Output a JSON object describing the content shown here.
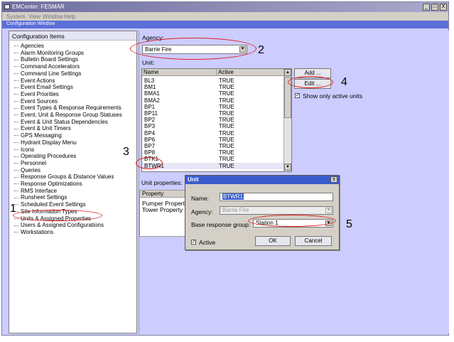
{
  "window": {
    "title": "EMCenter: FESMAR",
    "min": "_",
    "max": "□",
    "close": "X"
  },
  "menu": [
    "System",
    "View",
    "Window",
    "Help"
  ],
  "subwindow_title": "Configuration Window",
  "left": {
    "header": "Configuration Items",
    "items": [
      "Agencies",
      "Alarm Monitoring Groups",
      "Bulletin Board Settings",
      "Command Accelerators",
      "Command Line Settings",
      "Event Actions",
      "Event Email Settings",
      "Event Priorities",
      "Event Sources",
      "Event Types & Response Requirements",
      "Event, Unit & Response Group Statuses",
      "Event & Unit Status Dependencies",
      "Event & Unit Timers",
      "GPS Messaging",
      "Hydrant Display Menu",
      "Icons",
      "Operating Procedures",
      "Personnel",
      "Queries",
      "Response Groups & Distance Values",
      "Response Optimizations",
      "RMS Interface",
      "Runsheet Settings",
      "Scheduled Event Settings",
      "Site Information Types",
      "Units & Assigned Properties",
      "Users & Assigned Configurations",
      "Workstations"
    ]
  },
  "right": {
    "agency_label": "Agency:",
    "agency_value": "Barrie Fire",
    "unit_label": "Unit:",
    "col_name": "Name",
    "col_active": "Active",
    "units": [
      {
        "name": "BL3",
        "active": "TRUE"
      },
      {
        "name": "BM1",
        "active": "TRUE"
      },
      {
        "name": "BMA1",
        "active": "TRUE"
      },
      {
        "name": "BMA2",
        "active": "TRUE"
      },
      {
        "name": "BP1",
        "active": "TRUE"
      },
      {
        "name": "BP11",
        "active": "TRUE"
      },
      {
        "name": "BP2",
        "active": "TRUE"
      },
      {
        "name": "BP3",
        "active": "TRUE"
      },
      {
        "name": "BP4",
        "active": "TRUE"
      },
      {
        "name": "BP6",
        "active": "TRUE"
      },
      {
        "name": "BP7",
        "active": "TRUE"
      },
      {
        "name": "BP8",
        "active": "TRUE"
      },
      {
        "name": "BTK1",
        "active": "TRUE"
      },
      {
        "name": "BTWR1",
        "active": "TRUE"
      }
    ],
    "add_button": "Add ...",
    "edit_button": "Edit ...",
    "show_active_label": "Show only active units",
    "show_active_check": "✓",
    "unit_props_label": "Unit properties:",
    "props_header": "Property",
    "props": [
      "Pumper Property",
      "Tower Property"
    ]
  },
  "dialog": {
    "title": "Unit",
    "close": "x",
    "name_label": "Name:",
    "name_value": "BTWR1",
    "agency_label": "Agency:",
    "agency_value": "Barrie Fire",
    "brg_label": "Base response group:",
    "brg_value": "Station 1",
    "active_label": "Active",
    "active_check": "✓",
    "ok": "OK",
    "cancel": "Cancel"
  },
  "annotations": [
    "1",
    "2",
    "3",
    "4",
    "5"
  ],
  "colors": {
    "annotation_ellipse": "#e02020",
    "window_bg": "#ccccff",
    "dialog_title": "#3b5dcc"
  }
}
